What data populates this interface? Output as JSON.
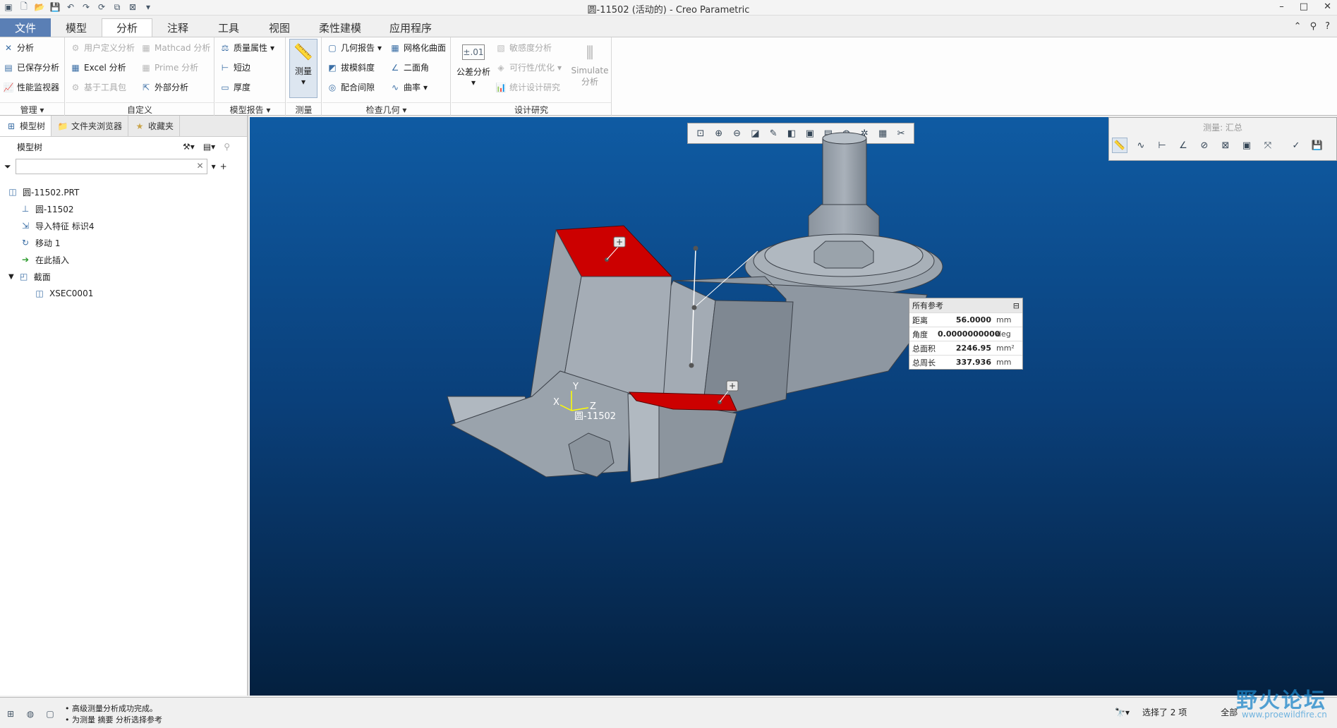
{
  "window": {
    "title": "圆-11502 (活动的) - Creo Parametric",
    "controls": [
      "–",
      "□",
      "✕"
    ]
  },
  "tabs": [
    {
      "label": "文件"
    },
    {
      "label": "模型"
    },
    {
      "label": "分析"
    },
    {
      "label": "注释"
    },
    {
      "label": "工具"
    },
    {
      "label": "视图"
    },
    {
      "label": "柔性建模"
    },
    {
      "label": "应用程序"
    }
  ],
  "ribbon": {
    "manage": {
      "label": "管理",
      "items": [
        "分析",
        "已保存分析",
        "性能监视器"
      ]
    },
    "custom": {
      "label": "自定义",
      "items": [
        "用户定义分析",
        "Mathcad 分析",
        "Excel 分析",
        "Prime 分析",
        "基于工具包",
        "外部分析"
      ]
    },
    "model_report": {
      "label": "模型报告",
      "items": [
        "质量属性",
        "短边",
        "厚度"
      ]
    },
    "measure": {
      "label": "测量",
      "button": "测量"
    },
    "inspect": {
      "label": "检查几何",
      "items": [
        "几何报告",
        "网格化曲面",
        "拔模斜度",
        "二面角",
        "配合间隙",
        "曲率"
      ]
    },
    "design_study": {
      "label": "设计研究",
      "tolerance_icon_text": "±.01",
      "tolerance": "公差分析",
      "items": [
        "敏感度分析",
        "可行性/优化",
        "统计设计研究"
      ],
      "simulate": [
        "Simulate",
        "分析"
      ]
    }
  },
  "left_panel": {
    "tabs": [
      "模型树",
      "文件夹浏览器",
      "收藏夹"
    ],
    "tree_title": "模型树",
    "tree": [
      {
        "label": "圆-11502.PRT",
        "indent": 0
      },
      {
        "label": "圆-11502",
        "indent": 1
      },
      {
        "label": "导入特征 标识4",
        "indent": 1
      },
      {
        "label": "移动 1",
        "indent": 1
      },
      {
        "label": "在此插入",
        "indent": 1
      },
      {
        "label": "截面",
        "indent": 1
      },
      {
        "label": "XSEC0001",
        "indent": 2
      }
    ]
  },
  "measure_panel": {
    "title": "测量: 汇总"
  },
  "results": {
    "header": "所有参考",
    "rows": [
      {
        "label": "距离",
        "value": "56.0000",
        "unit": "mm"
      },
      {
        "label": "角度",
        "value": "0.0000000000",
        "unit": "deg"
      },
      {
        "label": "总面积",
        "value": "2246.95",
        "unit": "mm²"
      },
      {
        "label": "总周长",
        "value": "337.936",
        "unit": "mm"
      }
    ]
  },
  "csys": {
    "x": "X",
    "y": "Y",
    "z": "Z",
    "name": "圆-11502"
  },
  "status": {
    "messages": [
      "• 高级测量分析成功完成。",
      "• 为测量 摘要 分析选择参考"
    ],
    "selection": "选择了 2 项",
    "filter": "全部"
  },
  "watermark": {
    "main": "野火论坛",
    "url": "www.proewildfire.cn"
  },
  "colors": {
    "file_tab": "#5a7fb5",
    "viewport_top": "#0f5ba3",
    "viewport_bottom": "#04203f",
    "highlight": "#cc0000",
    "part": "#9aa3ad"
  }
}
